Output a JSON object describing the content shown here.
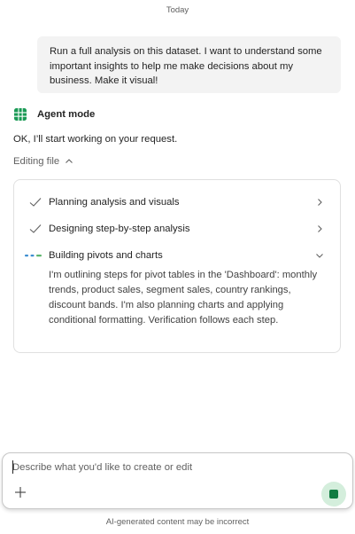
{
  "chat": {
    "date_separator": "Today",
    "user_message": "Run a full analysis on this dataset. I want to understand some important insights to help me make decisions about my business. Make it visual!",
    "agent": {
      "title": "Agent mode",
      "icon": "grid-icon",
      "status": "OK, I’ll start working on your request.",
      "editing_label": "Editing file"
    },
    "progress": {
      "steps": [
        {
          "label": "Planning analysis and visuals",
          "state": "done",
          "icon": "checkmark-icon"
        },
        {
          "label": "Designing step-by-step analysis",
          "state": "done",
          "icon": "checkmark-icon"
        },
        {
          "label": "Building pivots and charts",
          "state": "in-progress",
          "icon": "progress-dots-icon",
          "detail": "I'm outlining steps for pivot tables in the 'Dashboard': monthly trends, product sales, segment sales, country rankings, discount bands. I'm also planning charts and applying conditional formatting. Verification follows each step."
        }
      ]
    }
  },
  "composer": {
    "placeholder": "Describe what you'd like to create or edit",
    "add_icon": "plus-icon",
    "stop_icon": "stop-icon"
  },
  "footer": {
    "disclaimer": "AI-generated content may be incorrect"
  },
  "colors": {
    "accent_green": "#107c41",
    "stop_bg": "#d4eedc",
    "dot_blue": "#3e8ed0",
    "dot_green": "#5fb66e",
    "bubble_bg": "#f3f3f3"
  }
}
